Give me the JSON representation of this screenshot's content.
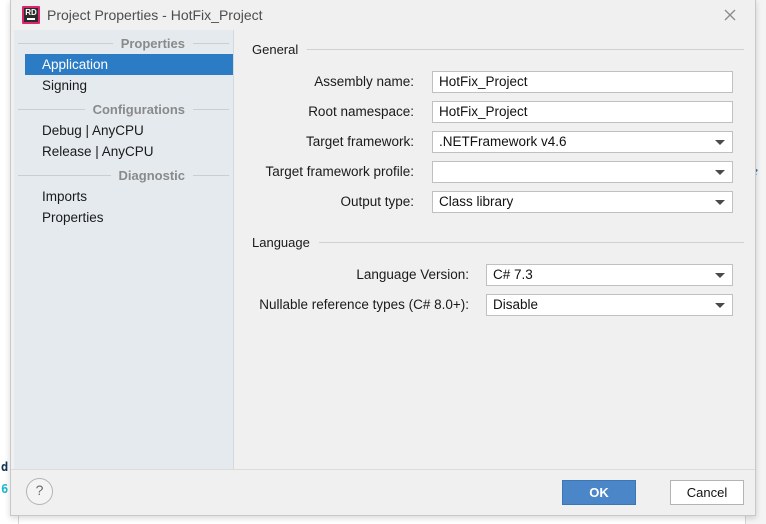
{
  "window": {
    "title": "Project Properties - HotFix_Project",
    "app_icon": "rider-icon",
    "app_icon_text": "RD",
    "close_icon": "close-icon"
  },
  "background": {
    "gutter_glyph_1": "d",
    "gutter_glyph_2": "6",
    "right_icon": "e"
  },
  "sidebar": {
    "groups": [
      {
        "header": "Properties",
        "items": [
          {
            "label": "Application",
            "selected": true
          },
          {
            "label": "Signing",
            "selected": false
          }
        ]
      },
      {
        "header": "Configurations",
        "items": [
          {
            "label": "Debug | AnyCPU",
            "selected": false
          },
          {
            "label": "Release | AnyCPU",
            "selected": false
          }
        ]
      },
      {
        "header": "Diagnostic",
        "items": [
          {
            "label": "Imports",
            "selected": false
          },
          {
            "label": "Properties",
            "selected": false
          }
        ]
      }
    ]
  },
  "content": {
    "sections": [
      {
        "title": "General",
        "fields": [
          {
            "label": "Assembly name:",
            "value": "HotFix_Project",
            "type": "text"
          },
          {
            "label": "Root namespace:",
            "value": "HotFix_Project",
            "type": "text"
          },
          {
            "label": "Target framework:",
            "value": ".NETFramework v4.6",
            "type": "combo"
          },
          {
            "label": "Target framework profile:",
            "value": "",
            "type": "combo"
          },
          {
            "label": "Output type:",
            "value": "Class library",
            "type": "combo"
          }
        ]
      },
      {
        "title": "Language",
        "fields": [
          {
            "label": "Language Version:",
            "value": "C# 7.3",
            "type": "combo"
          },
          {
            "label": "Nullable reference types (C# 8.0+):",
            "value": "Disable",
            "type": "combo"
          }
        ]
      }
    ]
  },
  "footer": {
    "help_label": "?",
    "ok_label": "OK",
    "cancel_label": "Cancel"
  },
  "colors": {
    "accent": "#2b7cc4",
    "primary_button": "#4a86c8",
    "sidebar_bg": "#e4eaee",
    "content_bg": "#f0f0f0",
    "brand_pink": "#d8276c"
  }
}
